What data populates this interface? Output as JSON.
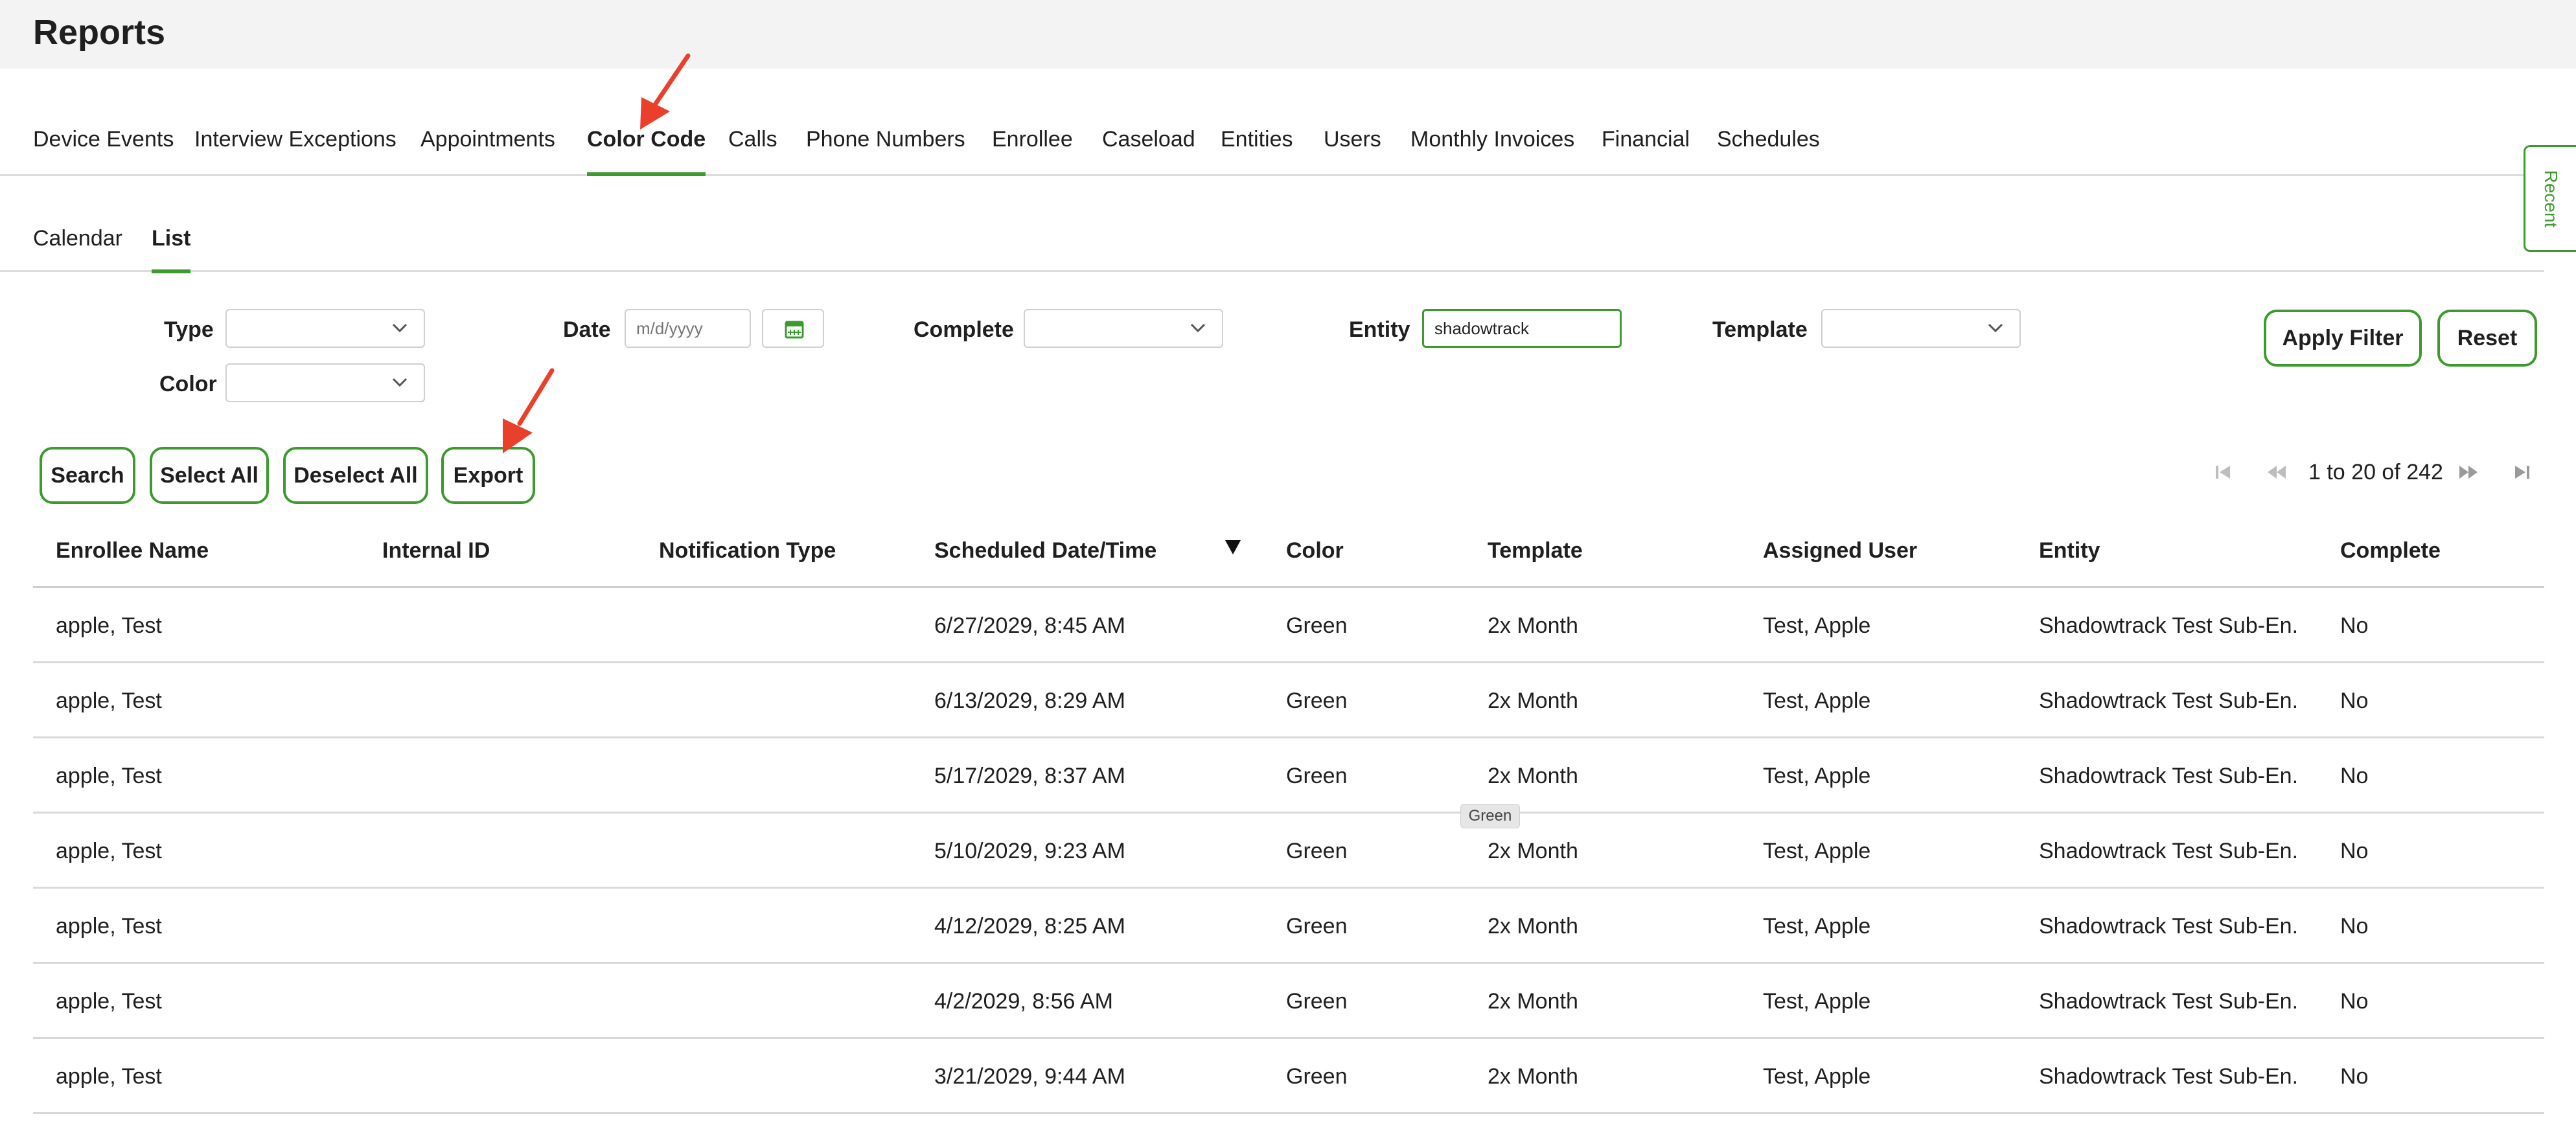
{
  "header": {
    "title": "Reports"
  },
  "tabs": [
    {
      "label": "Device Events"
    },
    {
      "label": "Interview Exceptions"
    },
    {
      "label": "Appointments"
    },
    {
      "label": "Color Code"
    },
    {
      "label": "Calls"
    },
    {
      "label": "Phone Numbers"
    },
    {
      "label": "Enrollee"
    },
    {
      "label": "Caseload"
    },
    {
      "label": "Entities"
    },
    {
      "label": "Users"
    },
    {
      "label": "Monthly Invoices"
    },
    {
      "label": "Financial"
    },
    {
      "label": "Schedules"
    }
  ],
  "active_tab": "Color Code",
  "subtabs": [
    {
      "label": "Calendar"
    },
    {
      "label": "List"
    }
  ],
  "active_subtab": "List",
  "recent_tab": {
    "label": "Recent"
  },
  "filters": {
    "type_label": "Type",
    "color_label": "Color",
    "date_label": "Date",
    "date_placeholder": "m/d/yyyy",
    "complete_label": "Complete",
    "entity_label": "Entity",
    "entity_value": "shadowtrack",
    "template_label": "Template",
    "apply_label": "Apply Filter",
    "reset_label": "Reset"
  },
  "actions": {
    "search": "Search",
    "select_all": "Select All",
    "deselect_all": "Deselect All",
    "export": "Export"
  },
  "pagination": {
    "text": "1 to 20 of 242"
  },
  "table": {
    "columns": [
      "Enrollee Name",
      "Internal ID",
      "Notification Type",
      "Scheduled Date/Time",
      "Color",
      "Template",
      "Assigned User",
      "Entity",
      "Complete"
    ],
    "rows": [
      [
        "apple, Test",
        "",
        "",
        "6/27/2029, 8:45 AM",
        "Green",
        "2x Month",
        "Test, Apple",
        "Shadowtrack Test Sub-En...",
        "No"
      ],
      [
        "apple, Test",
        "",
        "",
        "6/13/2029, 8:29 AM",
        "Green",
        "2x Month",
        "Test, Apple",
        "Shadowtrack Test Sub-En...",
        "No"
      ],
      [
        "apple, Test",
        "",
        "",
        "5/17/2029, 8:37 AM",
        "Green",
        "2x Month",
        "Test, Apple",
        "Shadowtrack Test Sub-En...",
        "No"
      ],
      [
        "apple, Test",
        "",
        "",
        "5/10/2029, 9:23 AM",
        "Green",
        "2x Month",
        "Test, Apple",
        "Shadowtrack Test Sub-En...",
        "No"
      ],
      [
        "apple, Test",
        "",
        "",
        "4/12/2029, 8:25 AM",
        "Green",
        "2x Month",
        "Test, Apple",
        "Shadowtrack Test Sub-En...",
        "No"
      ],
      [
        "apple, Test",
        "",
        "",
        "4/2/2029, 8:56 AM",
        "Green",
        "2x Month",
        "Test, Apple",
        "Shadowtrack Test Sub-En...",
        "No"
      ],
      [
        "apple, Test",
        "",
        "",
        "3/21/2029, 9:44 AM",
        "Green",
        "2x Month",
        "Test, Apple",
        "Shadowtrack Test Sub-En...",
        "No"
      ]
    ]
  },
  "tooltip": {
    "text": "Green"
  },
  "colors": {
    "accent": "#3d9a2f",
    "annotation_arrow": "#e8402a"
  },
  "icons": [
    "chevron-down-icon",
    "calendar-icon",
    "first-page-icon",
    "previous-page-icon",
    "next-page-icon",
    "last-page-icon",
    "sort-descending-icon"
  ]
}
